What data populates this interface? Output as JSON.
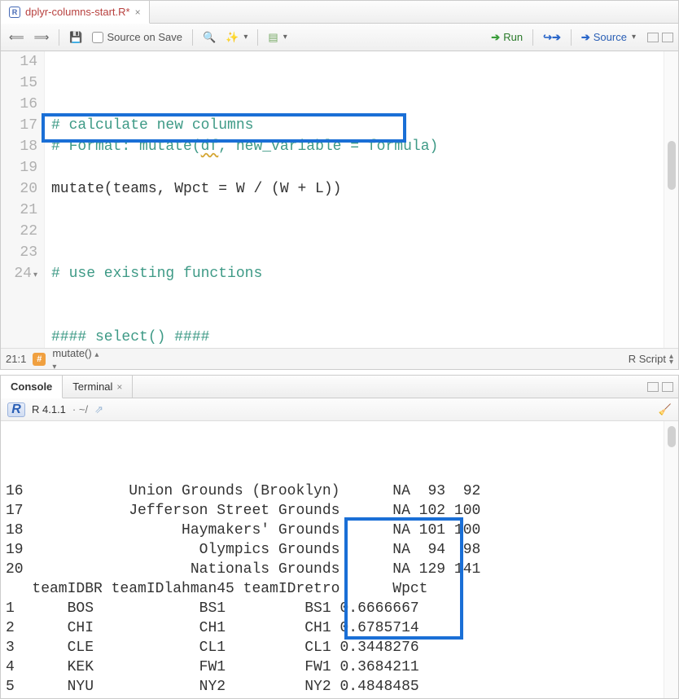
{
  "tab": {
    "filename": "dplyr-columns-start.R*",
    "icon_letter": "R"
  },
  "toolbar": {
    "source_on_save": "Source on Save",
    "run": "Run",
    "source": "Source"
  },
  "code": {
    "lines": [
      {
        "n": "14",
        "text": "# calculate new columns",
        "cls": "tok-comment"
      },
      {
        "n": "15",
        "html": "<span class='tok-comment'># Format: mutate(</span><span class='tok-comment squiggle'>df</span><span class='tok-comment'>, new_variable = formula)</span>"
      },
      {
        "n": "16",
        "text": "",
        "cls": ""
      },
      {
        "n": "17",
        "text": "mutate(teams, Wpct = W / (W + L))",
        "cls": "tok-ident"
      },
      {
        "n": "18",
        "text": "",
        "cls": ""
      },
      {
        "n": "19",
        "text": "",
        "cls": ""
      },
      {
        "n": "20",
        "text": "",
        "cls": ""
      },
      {
        "n": "21",
        "text": "# use existing functions",
        "cls": "tok-comment"
      },
      {
        "n": "22",
        "text": "",
        "cls": ""
      },
      {
        "n": "23",
        "text": "",
        "cls": ""
      },
      {
        "n": "24",
        "text": "#### select() ####",
        "cls": "tok-comment",
        "fold": true
      }
    ]
  },
  "status": {
    "cursor": "21:1",
    "scope": "mutate()",
    "lang": "R Script"
  },
  "console": {
    "tabs": {
      "console": "Console",
      "terminal": "Terminal"
    },
    "version": "R 4.1.1",
    "path": "· ~/",
    "grounds_rows": [
      {
        "n": "16",
        "park": "Union Grounds (Brooklyn)",
        "a": "NA",
        "b": "93",
        "c": "92"
      },
      {
        "n": "17",
        "park": "Jefferson Street Grounds",
        "a": "NA",
        "b": "102",
        "c": "100"
      },
      {
        "n": "18",
        "park": "Haymakers' Grounds",
        "a": "NA",
        "b": "101",
        "c": "100"
      },
      {
        "n": "19",
        "park": "Olympics Grounds",
        "a": "NA",
        "b": "94",
        "c": "98"
      },
      {
        "n": "20",
        "park": "Nationals Grounds",
        "a": "NA",
        "b": "129",
        "c": "141"
      }
    ],
    "hdr": {
      "c1": "teamIDBR",
      "c2": "teamIDlahman45",
      "c3": "teamIDretro",
      "c4": "Wpct"
    },
    "team_rows": [
      {
        "n": "1",
        "br": "BOS",
        "l45": "BS1",
        "ret": "BS1",
        "wpct": "0.6666667"
      },
      {
        "n": "2",
        "br": "CHI",
        "l45": "CH1",
        "ret": "CH1",
        "wpct": "0.6785714"
      },
      {
        "n": "3",
        "br": "CLE",
        "l45": "CL1",
        "ret": "CL1",
        "wpct": "0.3448276"
      },
      {
        "n": "4",
        "br": "KEK",
        "l45": "FW1",
        "ret": "FW1",
        "wpct": "0.3684211"
      },
      {
        "n": "5",
        "br": "NYU",
        "l45": "NY2",
        "ret": "NY2",
        "wpct": "0.4848485"
      }
    ]
  }
}
